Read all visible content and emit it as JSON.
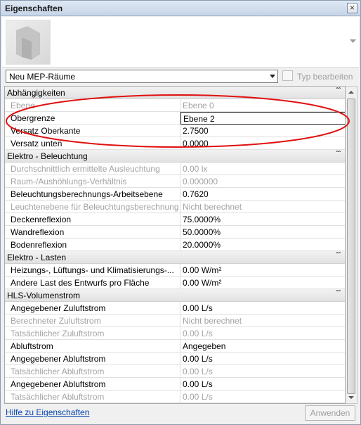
{
  "window": {
    "title": "Eigenschaften",
    "close_glyph": "×"
  },
  "type_selector": {
    "value": "Neu MEP-Räume",
    "edit_type_label": "Typ bearbeiten"
  },
  "categories": [
    {
      "label": "Abhängigkeiten",
      "toggle": "≈",
      "rows": [
        {
          "name": "Ebene",
          "value": "Ebene 0",
          "disabled": true
        },
        {
          "name": "Obergrenze",
          "value": "Ebene 2",
          "active": true
        },
        {
          "name": "Versatz Oberkante",
          "value": "2.7500"
        },
        {
          "name": "Versatz unten",
          "value": "0.0000"
        }
      ]
    },
    {
      "label": "Elektro - Beleuchtung",
      "toggle": "≈",
      "rows": [
        {
          "name": "Durchschnittlich ermittelte Ausleuchtung",
          "value": "0.00 lx",
          "disabled": true
        },
        {
          "name": "Raum-/Aushöhlungs-Verhältnis",
          "value": "0.000000",
          "disabled": true
        },
        {
          "name": "Beleuchtungsberechnungs-Arbeitsebene",
          "value": "0.7620"
        },
        {
          "name": "Leuchtenebene für Beleuchtungsberechnung",
          "value": "Nicht berechnet",
          "disabled": true
        },
        {
          "name": "Deckenreflexion",
          "value": "75.0000%"
        },
        {
          "name": "Wandreflexion",
          "value": "50.0000%"
        },
        {
          "name": "Bodenreflexion",
          "value": "20.0000%"
        }
      ]
    },
    {
      "label": "Elektro - Lasten",
      "toggle": "≈",
      "rows": [
        {
          "name": "Heizungs-, Lüftungs- und Klimatisierungs-...",
          "value": "0.00 W/m²"
        },
        {
          "name": "Andere Last des Entwurfs pro Fläche",
          "value": "0.00 W/m²"
        }
      ]
    },
    {
      "label": "HLS-Volumenstrom",
      "toggle": "≈",
      "rows": [
        {
          "name": "Angegebener Zuluftstrom",
          "value": "0.00 L/s"
        },
        {
          "name": "Berechneter Zuluftstrom",
          "value": "Nicht berechnet",
          "disabled": true
        },
        {
          "name": "Tatsächlicher Zuluftstrom",
          "value": "0.00 L/s",
          "disabled": true
        },
        {
          "name": "Abluftstrom",
          "value": "Angegeben"
        },
        {
          "name": "Angegebener Abluftstrom",
          "value": "0.00 L/s"
        },
        {
          "name": "Tatsächlicher Abluftstrom",
          "value": "0.00 L/s",
          "disabled": true
        },
        {
          "name": "Angegebener Abluftstrom",
          "value": "0.00 L/s"
        },
        {
          "name": "Tatsächlicher Abluftstrom",
          "value": "0.00 L/s",
          "disabled": true
        }
      ]
    }
  ],
  "footer": {
    "help_link": "Hilfe zu Eigenschaften",
    "apply_label": "Anwenden"
  },
  "colors": {
    "annotation_ellipse": "#e01010",
    "disabled_text": "#a3a3a3",
    "link": "#0645ad"
  }
}
